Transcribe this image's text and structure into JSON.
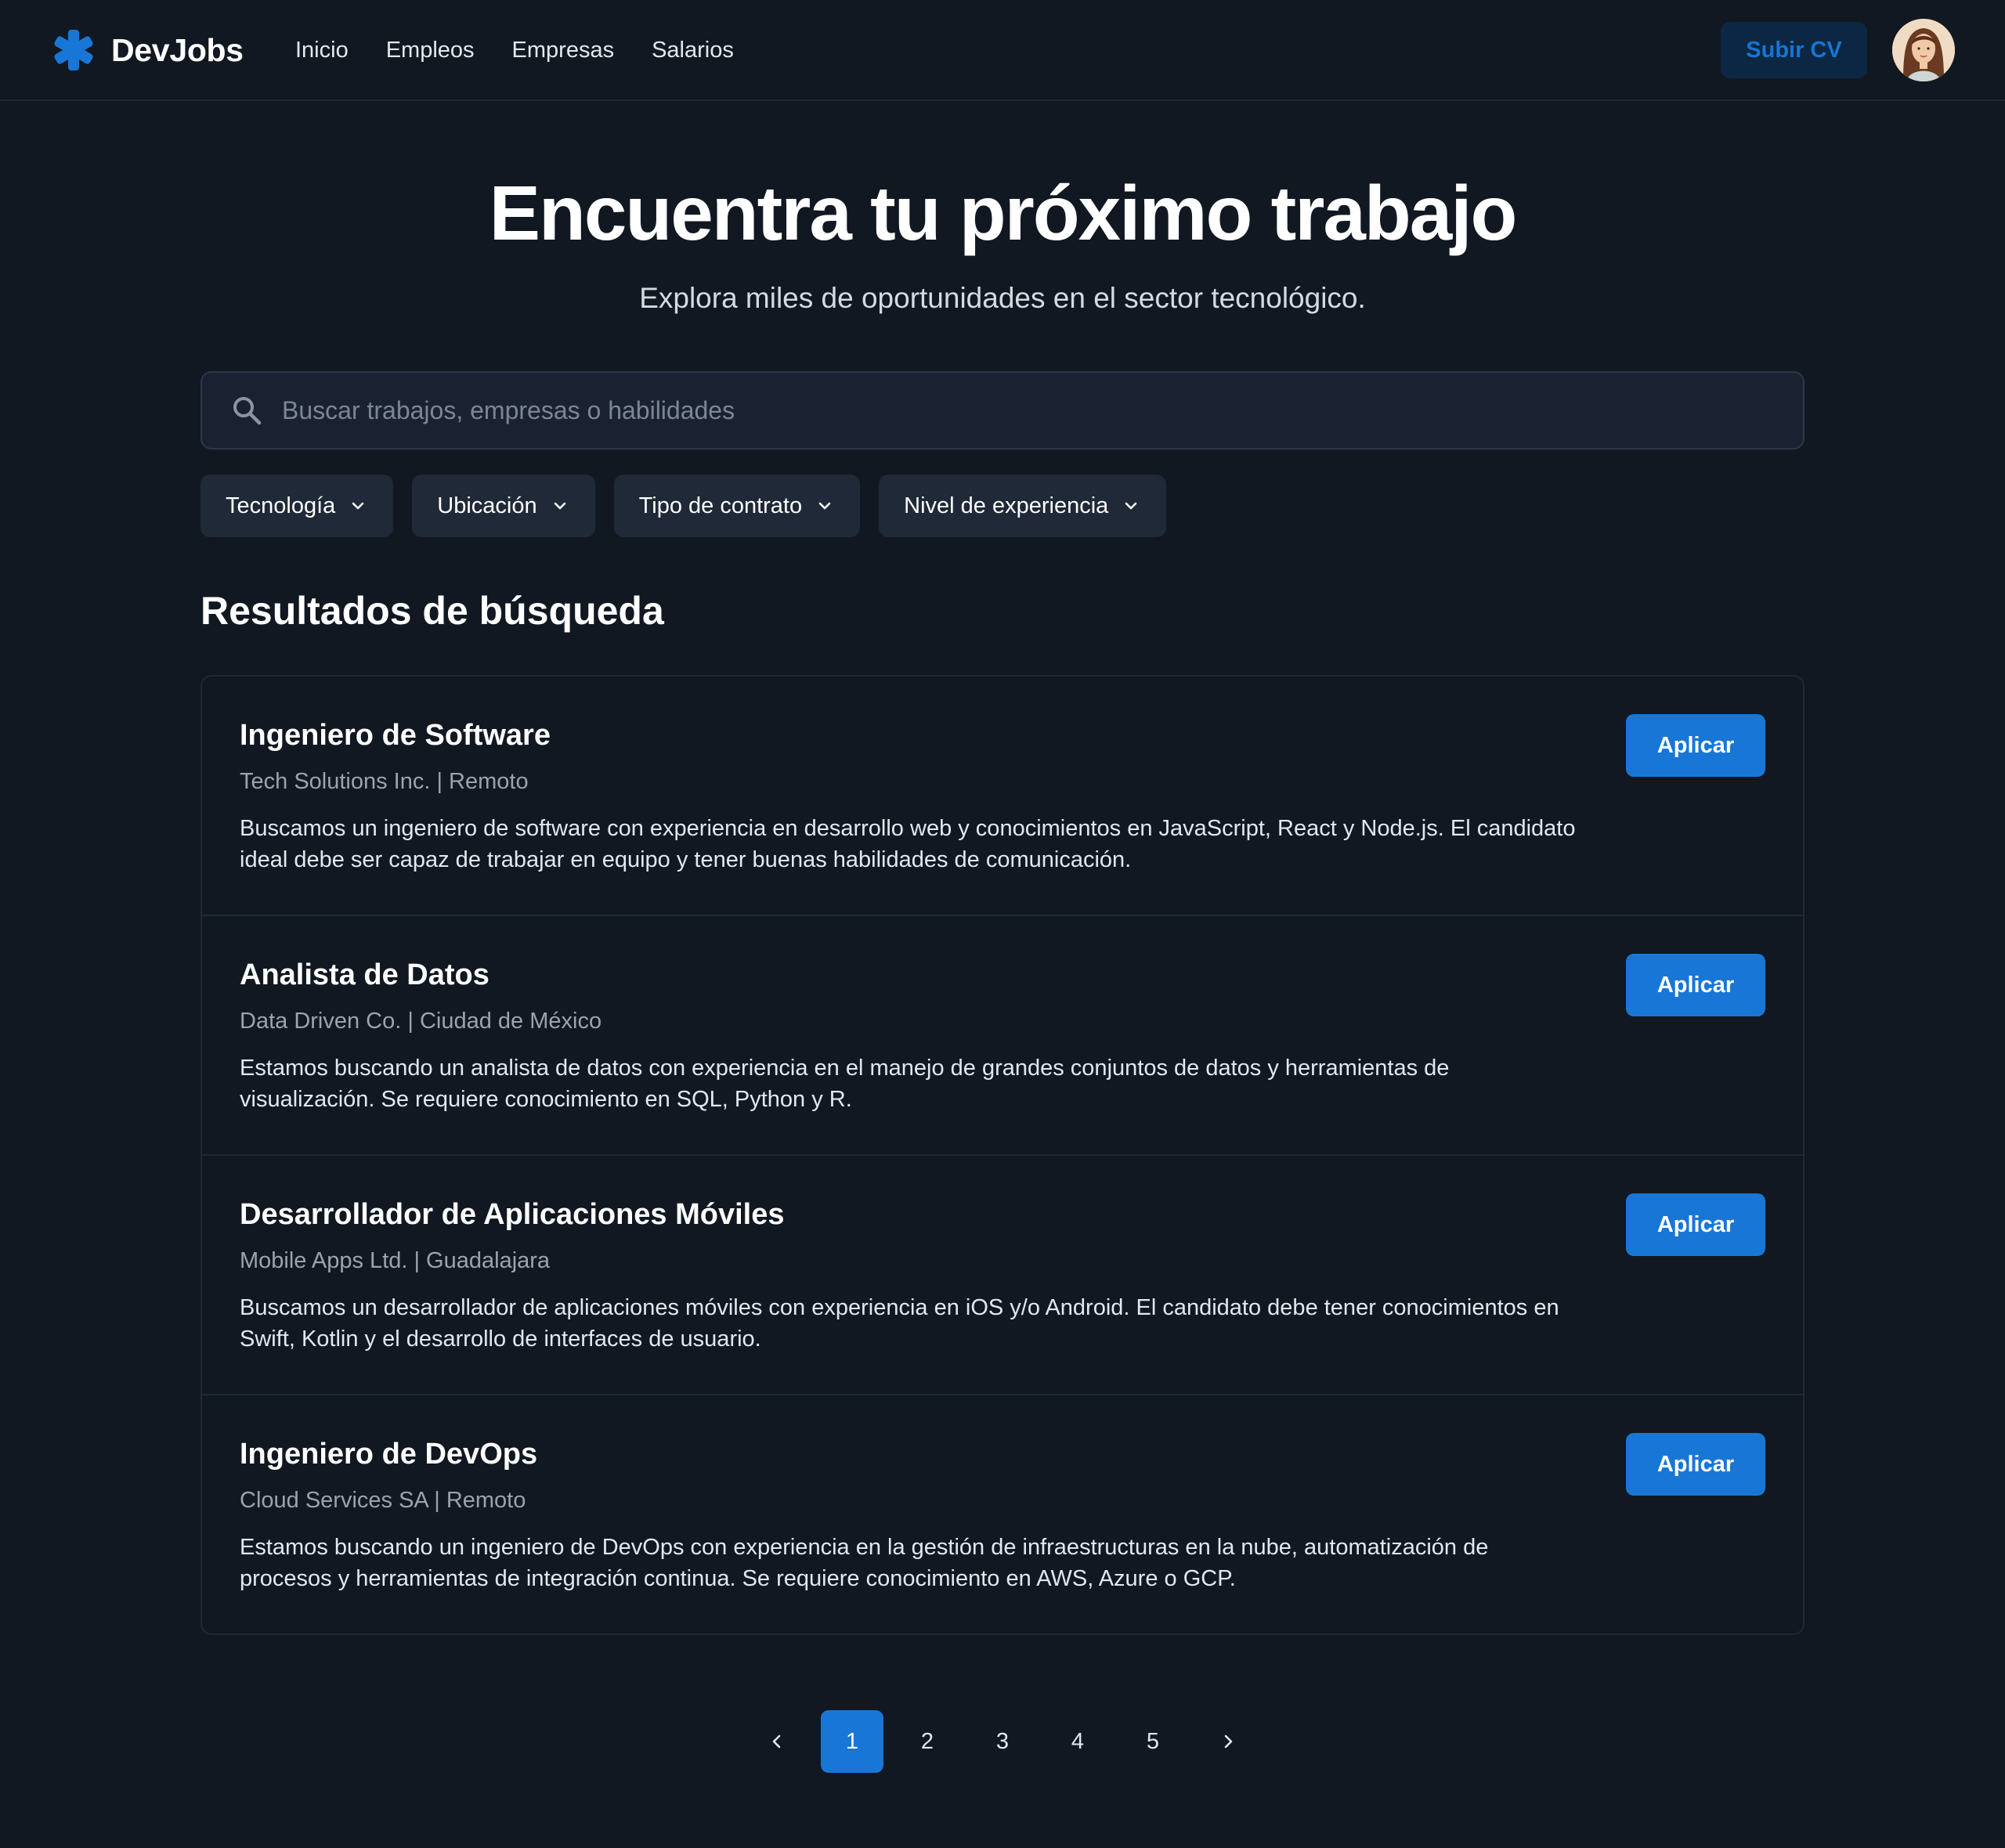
{
  "header": {
    "brand": "DevJobs",
    "nav": [
      "Inicio",
      "Empleos",
      "Empresas",
      "Salarios"
    ],
    "upload_label": "Subir CV"
  },
  "hero": {
    "title": "Encuentra tu próximo trabajo",
    "subtitle": "Explora miles de oportunidades en el sector tecnológico."
  },
  "search": {
    "placeholder": "Buscar trabajos, empresas o habilidades"
  },
  "filters": [
    "Tecnología",
    "Ubicación",
    "Tipo de contrato",
    "Nivel de experiencia"
  ],
  "results": {
    "title": "Resultados de búsqueda",
    "apply_label": "Aplicar",
    "jobs": [
      {
        "title": "Ingeniero de Software",
        "company": "Tech Solutions Inc.",
        "location": "Remoto",
        "meta": "Tech Solutions Inc. | Remoto",
        "description": "Buscamos un ingeniero de software con experiencia en desarrollo web y conocimientos en JavaScript, React y Node.js. El candidato ideal debe ser capaz de trabajar en equipo y tener buenas habilidades de comunicación."
      },
      {
        "title": "Analista de Datos",
        "company": "Data Driven Co.",
        "location": "Ciudad de México",
        "meta": "Data Driven Co. | Ciudad de México",
        "description": "Estamos buscando un analista de datos con experiencia en el manejo de grandes conjuntos de datos y herramientas de visualización. Se requiere conocimiento en SQL, Python y R."
      },
      {
        "title": "Desarrollador de Aplicaciones Móviles",
        "company": "Mobile Apps Ltd.",
        "location": "Guadalajara",
        "meta": "Mobile Apps Ltd. | Guadalajara",
        "description": "Buscamos un desarrollador de aplicaciones móviles con experiencia en iOS y/o Android. El candidato debe tener conocimientos en Swift, Kotlin y el desarrollo de interfaces de usuario."
      },
      {
        "title": "Ingeniero de DevOps",
        "company": "Cloud Services SA",
        "location": "Remoto",
        "meta": "Cloud Services SA | Remoto",
        "description": "Estamos buscando un ingeniero de DevOps con experiencia en la gestión de infraestructuras en la nube, automatización de procesos y herramientas de integración continua. Se requiere conocimiento en AWS, Azure o GCP."
      }
    ]
  },
  "pagination": {
    "pages": [
      "1",
      "2",
      "3",
      "4",
      "5"
    ],
    "current": "1",
    "prev_icon": "chevron-left-icon",
    "next_icon": "chevron-right-icon"
  },
  "icons": {
    "logo": "asterisk-logo-icon",
    "search": "search-icon",
    "filter_chevron": "chevron-down-icon"
  },
  "colors": {
    "background": "#111821",
    "accent": "#1877d6",
    "accent_dark": "#0c2744",
    "panel": "#1f2937",
    "border": "#1f2834",
    "muted_text": "#9ca3af"
  }
}
